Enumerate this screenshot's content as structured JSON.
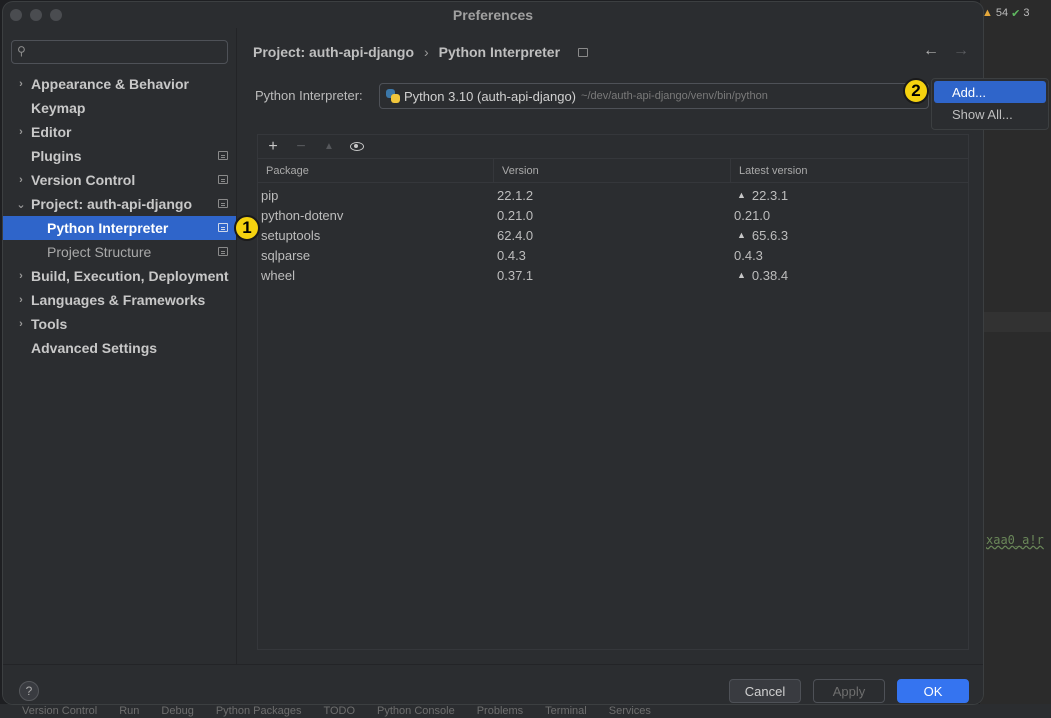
{
  "window": {
    "title": "Preferences"
  },
  "background_ide": {
    "warnings_count": "54",
    "checks_count": "3",
    "code_snippet": "xaa0_a!r",
    "bottom_tabs": [
      "Version Control",
      "Run",
      "Debug",
      "Python Packages",
      "TODO",
      "Python Console",
      "Problems",
      "Terminal",
      "Services"
    ]
  },
  "sidebar": {
    "search_placeholder": "",
    "items": [
      {
        "label": "Appearance & Behavior",
        "expandable": true,
        "project_scoped": false
      },
      {
        "label": "Keymap",
        "expandable": false,
        "project_scoped": false
      },
      {
        "label": "Editor",
        "expandable": true,
        "project_scoped": false
      },
      {
        "label": "Plugins",
        "expandable": false,
        "project_scoped": true
      },
      {
        "label": "Version Control",
        "expandable": true,
        "project_scoped": true
      },
      {
        "label": "Project: auth-api-django",
        "expandable": true,
        "expanded": true,
        "project_scoped": true
      },
      {
        "label": "Python Interpreter",
        "sub": true,
        "selected": true,
        "project_scoped": true
      },
      {
        "label": "Project Structure",
        "sub": true,
        "project_scoped": true
      },
      {
        "label": "Build, Execution, Deployment",
        "expandable": true,
        "project_scoped": false
      },
      {
        "label": "Languages & Frameworks",
        "expandable": true,
        "project_scoped": false
      },
      {
        "label": "Tools",
        "expandable": true,
        "project_scoped": false
      },
      {
        "label": "Advanced Settings",
        "expandable": false,
        "project_scoped": false
      }
    ]
  },
  "breadcrumb": {
    "parent": "Project: auth-api-django",
    "separator": "›",
    "current": "Python Interpreter"
  },
  "interpreter": {
    "label": "Python Interpreter:",
    "name": "Python 3.10 (auth-api-django)",
    "path": "~/dev/auth-api-django/venv/bin/python"
  },
  "packages_table": {
    "columns": [
      "Package",
      "Version",
      "Latest version"
    ],
    "rows": [
      {
        "package": "pip",
        "version": "22.1.2",
        "latest": "22.3.1",
        "upgrade": true
      },
      {
        "package": "python-dotenv",
        "version": "0.21.0",
        "latest": "0.21.0",
        "upgrade": false
      },
      {
        "package": "setuptools",
        "version": "62.4.0",
        "latest": "65.6.3",
        "upgrade": true
      },
      {
        "package": "sqlparse",
        "version": "0.4.3",
        "latest": "0.4.3",
        "upgrade": false
      },
      {
        "package": "wheel",
        "version": "0.37.1",
        "latest": "0.38.4",
        "upgrade": true
      }
    ]
  },
  "popup_menu": {
    "items": [
      "Add...",
      "Show All..."
    ],
    "selected_index": 0
  },
  "markers": {
    "one": "1",
    "two": "2"
  },
  "footer": {
    "help": "?",
    "cancel": "Cancel",
    "apply": "Apply",
    "ok": "OK"
  },
  "colors": {
    "accent": "#2f65ca",
    "ok_button": "#3574f0",
    "marker": "#f5d20f"
  }
}
